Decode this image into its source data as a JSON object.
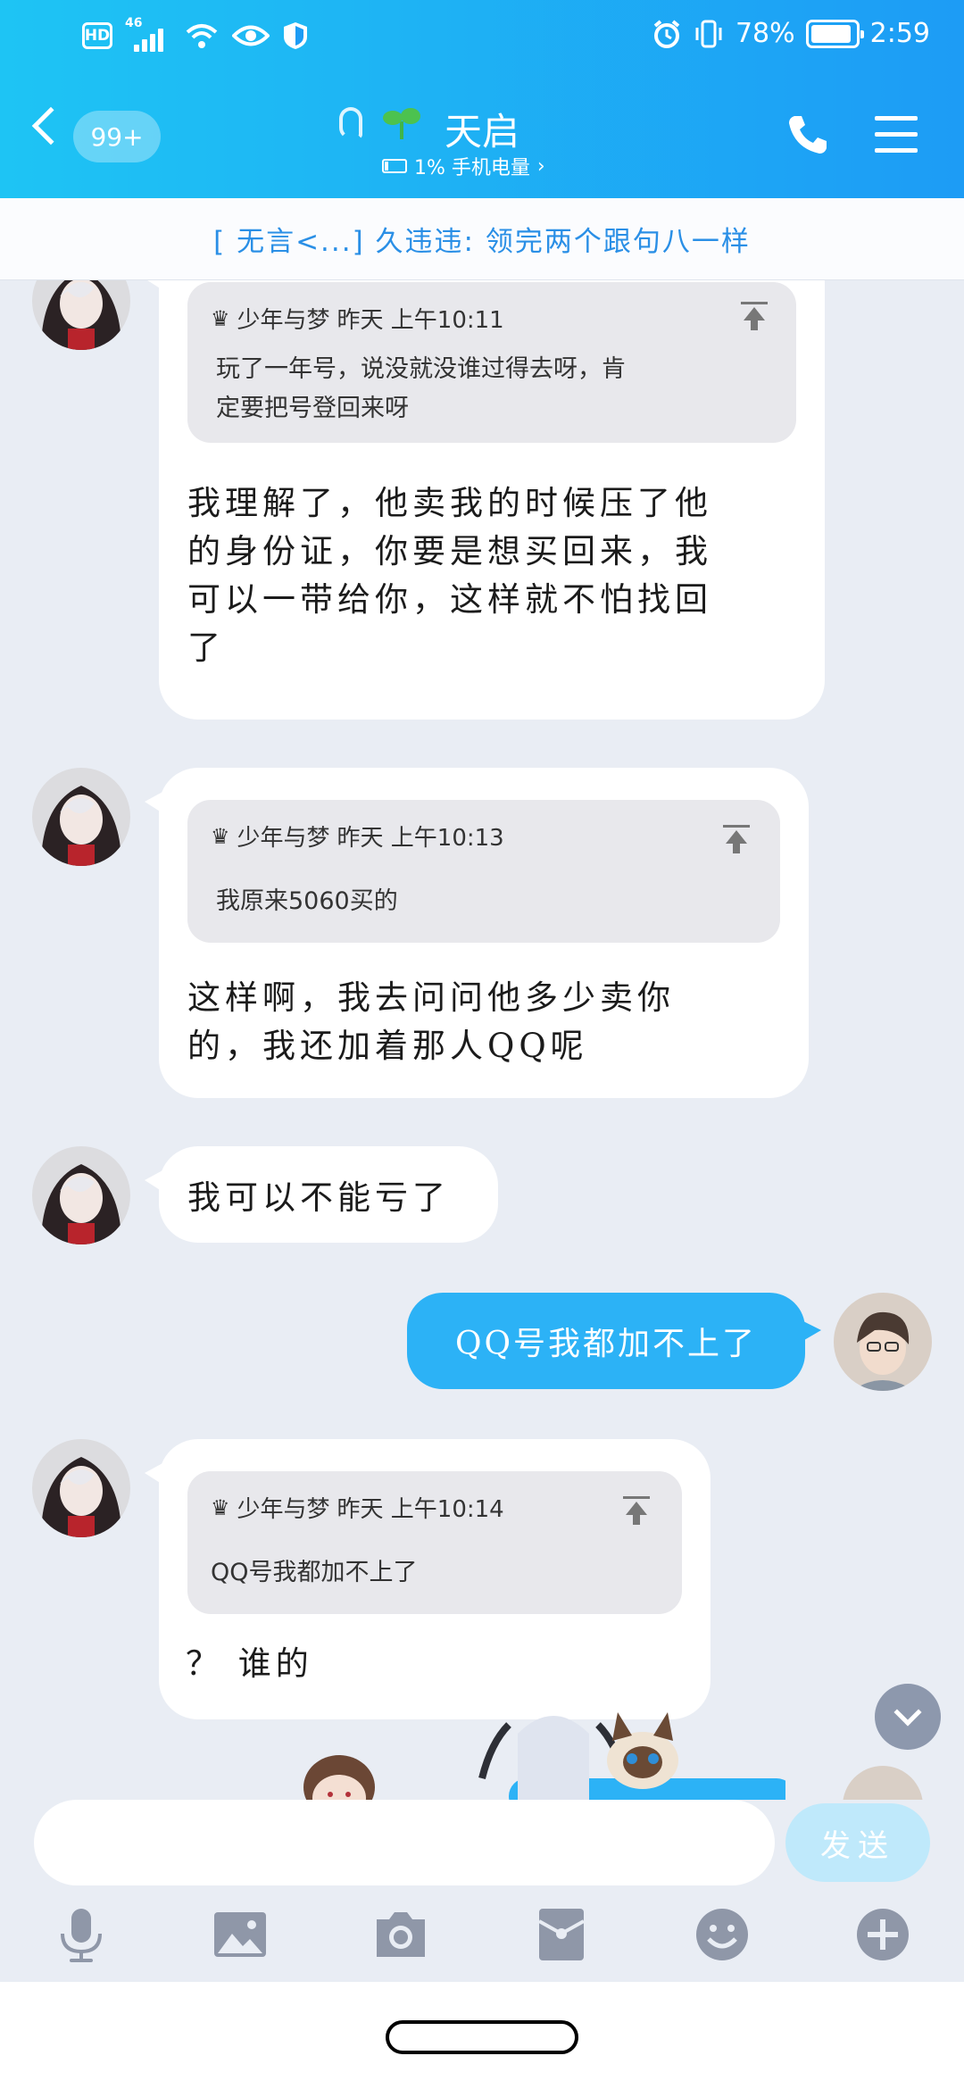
{
  "status_bar": {
    "hd": "HD",
    "network": "46",
    "battery": "78%",
    "time": "2:59"
  },
  "header": {
    "unread_badge": "99+",
    "title": "天启",
    "subtitle": "1% 手机电量",
    "subtitle_arrow": "›"
  },
  "banner": {
    "text": "[  无言<...] 久违违: 领完两个跟句八一样"
  },
  "messages": [
    {
      "quote_author": "少年与梦",
      "quote_time": "昨天 上午10:11",
      "quote_line1": "玩了一年号，说没就没谁过得去呀，肯",
      "quote_line2": "定要把号登回来呀",
      "text_line1": "我理解了，他卖我的时候压了他",
      "text_line2": "的身份证，你要是想买回来，我",
      "text_line3": "可以一带给你，这样就不怕找回",
      "text_line4": "了"
    },
    {
      "quote_author": "少年与梦",
      "quote_time": "昨天 上午10:13",
      "quote_line1": "我原来5060买的",
      "text_line1": "这样啊，我去问问他多少卖你",
      "text_line2": "的，我还加着那人QQ呢"
    },
    {
      "text_line1": "我可以不能亏了"
    },
    {
      "text_line1": "QQ号我都加不上了"
    },
    {
      "quote_author": "少年与梦",
      "quote_time": "昨天 上午10:14",
      "quote_line1": "QQ号我都加不上了",
      "text_line1": "？ 谁的"
    }
  ],
  "input": {
    "send_label": "发送"
  },
  "toolbar_icons": [
    "microphone-icon",
    "image-icon",
    "camera-icon",
    "red-packet-icon",
    "emoji-icon",
    "plus-icon"
  ],
  "colors": {
    "header_start": "#1ec4f4",
    "header_end": "#1d9cf5",
    "my_bubble": "#2cb2f6",
    "chat_bg": "#e9edf4",
    "banner_text": "#2a8fe6"
  }
}
